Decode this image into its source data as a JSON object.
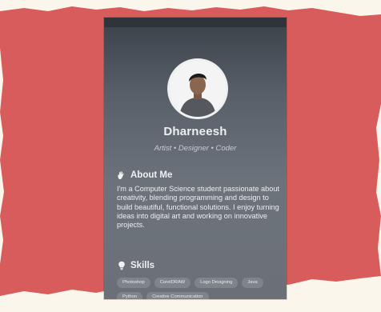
{
  "profile": {
    "name": "Dharneesh",
    "tagline": "Artist • Designer • Coder"
  },
  "about": {
    "title": "About Me",
    "icon": "waving-hand-icon",
    "text": "I'm a Computer Science student passionate about creativity, blending programming and design to build beautiful, functional solutions. I enjoy turning ideas into digital art and working on innovative projects."
  },
  "skills": {
    "title": "Skills",
    "icon": "lightbulb-icon",
    "items": [
      "Photoshop",
      "CorelDRAW",
      "Logo Designing",
      "Java",
      "Python",
      "Creative Communication"
    ]
  },
  "colors": {
    "paper_red": "#d95c5c",
    "page_bg": "#fbf6ec"
  }
}
